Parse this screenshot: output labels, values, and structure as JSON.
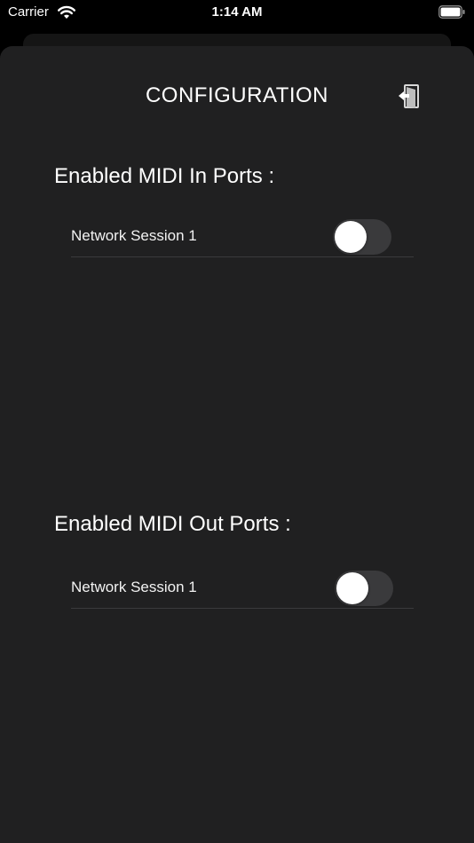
{
  "status_bar": {
    "carrier": "Carrier",
    "time": "1:14 AM"
  },
  "header": {
    "title": "CONFIGURATION",
    "exit_icon": "exit-door-icon"
  },
  "midi_in": {
    "header": "Enabled MIDI In Ports :",
    "ports": [
      {
        "label": "Network Session 1",
        "enabled": false
      }
    ]
  },
  "midi_out": {
    "header": "Enabled MIDI Out Ports :",
    "ports": [
      {
        "label": "Network Session 1",
        "enabled": false
      }
    ]
  },
  "colors": {
    "sheet_background": "#202021",
    "toggle_off": "#3a3a3c",
    "knob": "#ffffff"
  }
}
